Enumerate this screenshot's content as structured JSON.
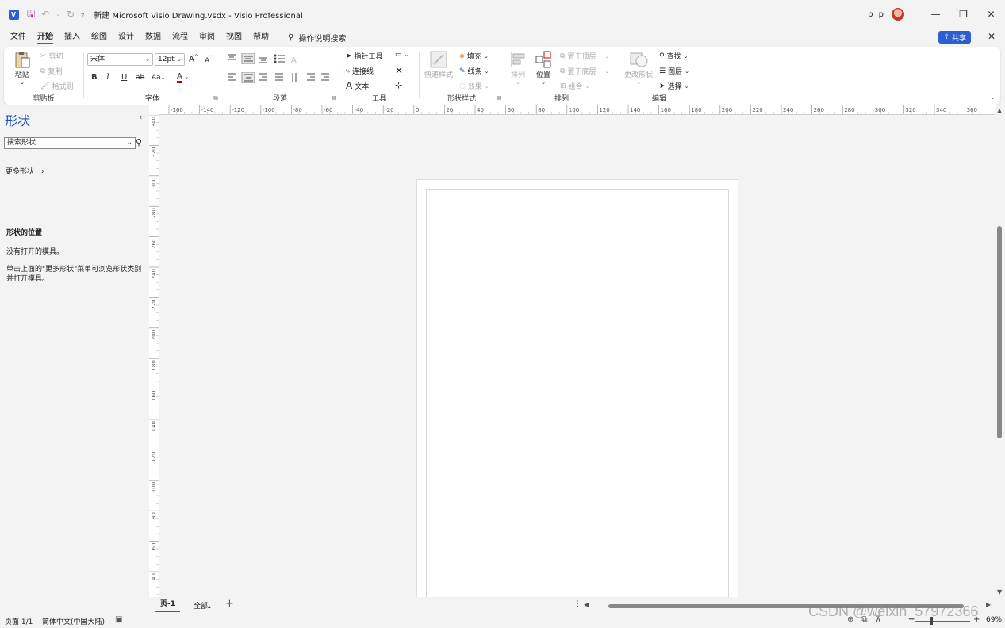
{
  "titlebar": {
    "file_title": "新建 Microsoft Visio Drawing.vsdx",
    "separator": "-",
    "app_name": "Visio Professional",
    "user_name": "p p",
    "window_controls": {
      "minimize": "—",
      "restore": "❐",
      "close": "✕"
    }
  },
  "tabs": [
    "文件",
    "开始",
    "插入",
    "绘图",
    "设计",
    "数据",
    "流程",
    "审阅",
    "视图",
    "帮助"
  ],
  "active_tab": "开始",
  "tell_me": "操作说明搜索",
  "share_label": "共享",
  "ribbon": {
    "clipboard": {
      "label": "剪贴板",
      "paste": "粘贴",
      "cut": "剪切",
      "copy": "复制",
      "format_painter": "格式刷"
    },
    "font": {
      "label": "字体",
      "font_name": "宋体",
      "font_size": "12pt",
      "grow": "A^",
      "shrink": "A^",
      "bold": "B",
      "italic": "I",
      "underline": "U",
      "strike": "ab",
      "case": "Aa",
      "color": "A"
    },
    "paragraph": {
      "label": "段落"
    },
    "tools": {
      "label": "工具",
      "pointer": "指针工具",
      "connector": "连接线",
      "text": "文本"
    },
    "shape_styles": {
      "label": "形状样式",
      "quick_styles": "快速样式",
      "fill": "填充",
      "line": "线条",
      "effects": "效果"
    },
    "arrange": {
      "label": "排列",
      "align": "排列",
      "position": "位置",
      "bring_front": "置于顶层",
      "send_back": "置于底层",
      "group": "组合"
    },
    "editing": {
      "label": "编辑",
      "change_shape": "更改形状",
      "find": "查找",
      "layers": "图层",
      "select": "选择"
    }
  },
  "shapes_pane": {
    "title": "形状",
    "search_placeholder": "搜索形状",
    "more_shapes": "更多形状",
    "heading": "形状的位置",
    "no_stencils": "没有打开的模具。",
    "hint": "单击上面的\"更多形状\"菜单可浏览形状类别并打开模具。"
  },
  "hruler_labels": [
    "-160",
    "-140",
    "-120",
    "-100",
    "-80",
    "-60",
    "-40",
    "-20",
    "0",
    "20",
    "40",
    "60",
    "80",
    "100",
    "120",
    "140",
    "160",
    "180",
    "200",
    "220",
    "240",
    "260",
    "280",
    "300",
    "320",
    "340",
    "360"
  ],
  "vruler_labels": [
    "340",
    "320",
    "300",
    "280",
    "260",
    "240",
    "220",
    "200",
    "180",
    "160",
    "140",
    "120",
    "100",
    "80",
    "60",
    "40"
  ],
  "page_tabs": {
    "current": "页-1",
    "all": "全部",
    "add": "+"
  },
  "statusbar": {
    "page": "页面 1/1",
    "language": "简体中文(中国大陆)",
    "zoom": "69%"
  },
  "watermark": "CSDN @weixin_57972366",
  "colors": {
    "accent": "#2d5fd3",
    "save_icon": "#a1328e",
    "title_blue": "#1f4fb5"
  }
}
